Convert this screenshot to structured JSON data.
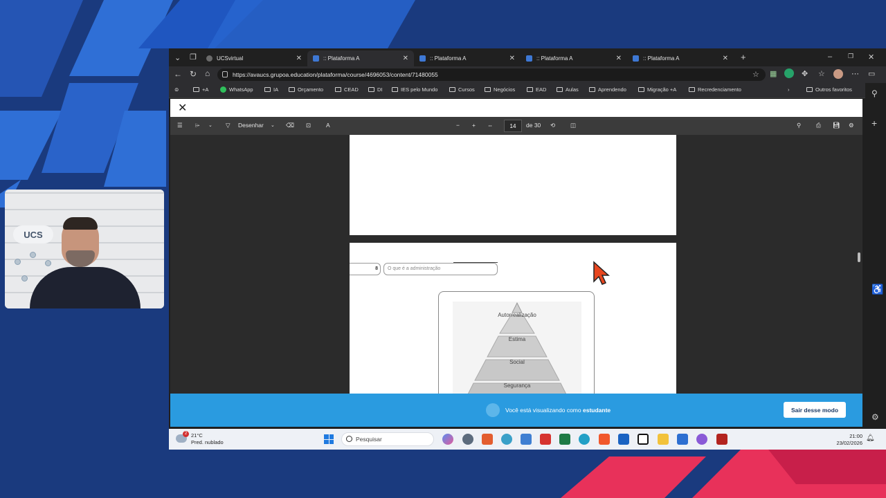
{
  "browser": {
    "tabs": [
      {
        "label": "UCSvirtual",
        "active": false
      },
      {
        "label": ":: Plataforma A",
        "active": true
      },
      {
        "label": ":: Plataforma A",
        "active": false
      },
      {
        "label": ":: Plataforma A",
        "active": false
      },
      {
        "label": ":: Plataforma A",
        "active": false
      }
    ],
    "url": "https://avaucs.grupoa.education/plataforma/course/4696053/content/71480055",
    "bookmarks": [
      "+A",
      "WhatsApp",
      "IA",
      "Orçamento",
      "CEAD",
      "DI",
      "IES pelo Mundo",
      "Cursos",
      "Negócios",
      "EAD",
      "Aulas",
      "Aprendendo",
      "Migração +A",
      "Recredenciamento"
    ],
    "other_favorites": "Outros favoritos"
  },
  "pdf_toolbar": {
    "draw_label": "Desenhar",
    "page_current": "14",
    "page_total": "de 30"
  },
  "pdf_page": {
    "number": "8",
    "title": "O que é a administração",
    "pyramid_levels": [
      "Autorrealização",
      "Estima",
      "Social",
      "Segurança"
    ]
  },
  "banner": {
    "message_prefix": "Você está visualizando como",
    "message_role": "estudante",
    "exit_button": "Sair desse modo"
  },
  "taskbar": {
    "temperature": "21°C",
    "weather": "Pred. nublado",
    "weather_badge": "2",
    "search_placeholder": "Pesquisar",
    "time": "21:00",
    "date": "23/02/2026"
  },
  "colors": {
    "banner": "#2a9be0",
    "background": "#1a3a7e",
    "accent_red": "#e8315a",
    "cursor": "#e8461e"
  }
}
